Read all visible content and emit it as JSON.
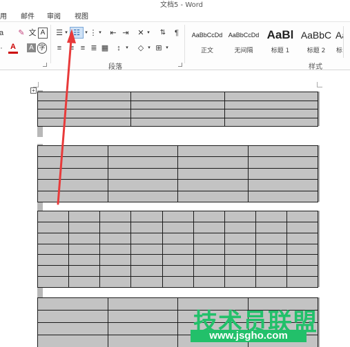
{
  "window": {
    "title": "文档5 - Word"
  },
  "tabs": [
    {
      "label": "用"
    },
    {
      "label": "邮件"
    },
    {
      "label": "审阅"
    },
    {
      "label": "视图"
    }
  ],
  "ribbon": {
    "paragraph_group_label": "段落",
    "styles_group_label": "样式",
    "styles": [
      {
        "sample": "AaBbCcDd",
        "name": "正文"
      },
      {
        "sample": "AaBbCcDd",
        "name": "无间隔"
      },
      {
        "sample": "AaBl",
        "name": "标题 1"
      },
      {
        "sample": "AaBbC",
        "name": "标题 2"
      },
      {
        "sample": "Aa",
        "name": "标"
      }
    ],
    "accent_color": "#cfe2f6"
  },
  "document": {
    "tables": [
      {
        "rows": 4,
        "cols": 3
      },
      {
        "rows": 5,
        "cols": 4
      },
      {
        "rows": 7,
        "cols": 9
      },
      {
        "rows": 4,
        "cols": 4
      }
    ]
  },
  "annotation": {
    "arrow_color": "#e83a3a"
  },
  "watermark": {
    "text": "技术员联盟",
    "url": "www.jsgho.com",
    "color": "#22c06a"
  }
}
